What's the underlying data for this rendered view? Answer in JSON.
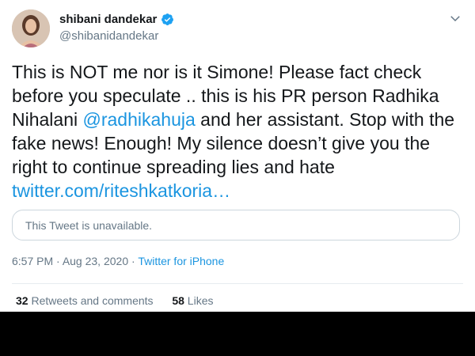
{
  "author": {
    "name": "shibani dandekar",
    "handle": "@shibanidandekar",
    "verified_icon": "verified-badge-icon"
  },
  "tweet": {
    "text_1": "This is NOT me nor is it Simone! Please fact check before you speculate .. this is his PR person Radhika Nihalani ",
    "mention": "@radhikahuja",
    "text_2": " and her assistant. Stop with the fake news! Enough! My silence doesn’t give you the right to continue spreading lies and hate ",
    "link": "twitter.com/riteshkatkoria…"
  },
  "quote": {
    "unavailable": "This Tweet is unavailable."
  },
  "meta": {
    "time": "6:57 PM",
    "sep1": " · ",
    "date": "Aug 23, 2020",
    "sep2": " · ",
    "source": "Twitter for iPhone"
  },
  "stats": {
    "retweets_count": "32",
    "retweets_label": "Retweets and comments",
    "likes_count": "58",
    "likes_label": "Likes"
  },
  "colors": {
    "link": "#1b95e0",
    "text": "#14171a",
    "muted": "#657786",
    "background_below": "#000000"
  }
}
